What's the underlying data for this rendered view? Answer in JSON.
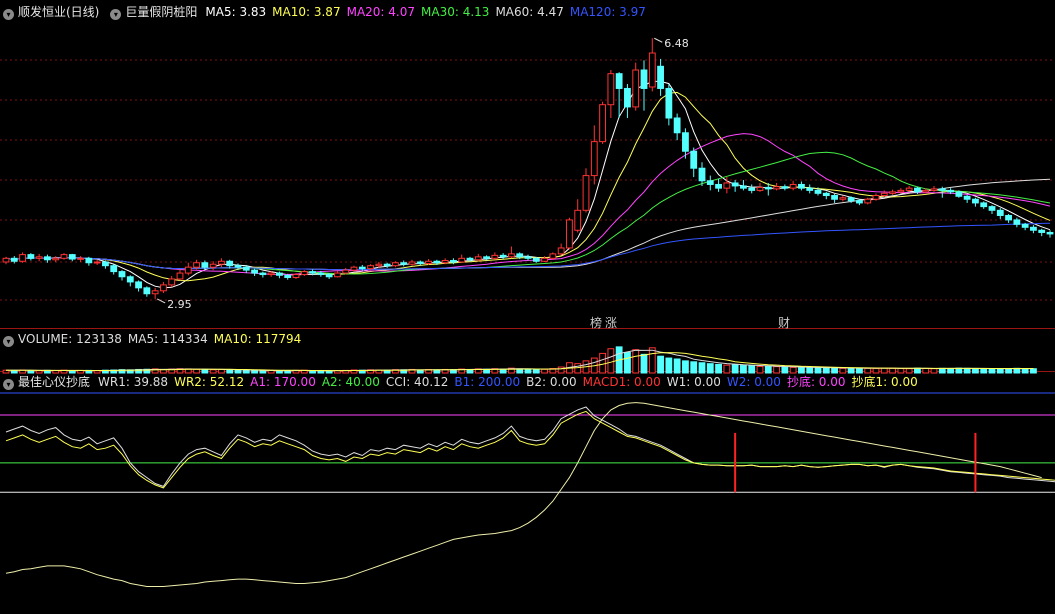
{
  "main": {
    "title": "顺发恒业(日线)",
    "indicator": "巨量假阴桩阳",
    "ma": [
      {
        "label": "MA5: 3.83",
        "color": "#ffffff"
      },
      {
        "label": "MA10: 3.87",
        "color": "#ffff55"
      },
      {
        "label": "MA20: 4.07",
        "color": "#ff44ff"
      },
      {
        "label": "MA30: 4.13",
        "color": "#44ee44"
      },
      {
        "label": "MA60: 4.47",
        "color": "#dddddd"
      },
      {
        "label": "MA120: 3.97",
        "color": "#3355ff"
      }
    ],
    "high_label": "6.48",
    "low_label": "2.95",
    "tags": [
      {
        "text": "榜",
        "color": "#ff6666"
      },
      {
        "text": "涨",
        "color": "#ff6666"
      },
      {
        "text": "财",
        "color": "#66aaff"
      }
    ]
  },
  "volume": {
    "title": "VOLUME: 123138",
    "items": [
      {
        "label": "MA5: 114334",
        "color": "#dddddd"
      },
      {
        "label": "MA10: 117794",
        "color": "#ffff55"
      }
    ]
  },
  "indicator": {
    "title": "最佳心仪抄底",
    "items": [
      {
        "label": "WR1: 39.88",
        "color": "#dddddd"
      },
      {
        "label": "WR2: 52.12",
        "color": "#ffff55"
      },
      {
        "label": "A1: 170.00",
        "color": "#ff44ff"
      },
      {
        "label": "A2: 40.00",
        "color": "#44ee44"
      },
      {
        "label": "CCI: 40.12",
        "color": "#dddddd"
      },
      {
        "label": "B1: 200.00",
        "color": "#3355ff"
      },
      {
        "label": "B2: 0.00",
        "color": "#dddddd"
      },
      {
        "label": "MACD1: 0.00",
        "color": "#ff3333"
      },
      {
        "label": "W1: 0.00",
        "color": "#dddddd"
      },
      {
        "label": "W2: 0.00",
        "color": "#3355ff"
      },
      {
        "label": "抄底: 0.00",
        "color": "#ff44ff"
      },
      {
        "label": "抄底1: 0.00",
        "color": "#ffff55"
      }
    ]
  },
  "chart_data": {
    "type": "candlestick",
    "candles": [
      [
        3.45,
        3.5,
        3.42,
        3.52
      ],
      [
        3.5,
        3.46,
        3.43,
        3.53
      ],
      [
        3.46,
        3.55,
        3.44,
        3.58
      ],
      [
        3.55,
        3.5,
        3.47,
        3.57
      ],
      [
        3.5,
        3.52,
        3.46,
        3.56
      ],
      [
        3.52,
        3.48,
        3.44,
        3.55
      ],
      [
        3.48,
        3.5,
        3.45,
        3.53
      ],
      [
        3.5,
        3.55,
        3.48,
        3.57
      ],
      [
        3.55,
        3.49,
        3.46,
        3.56
      ],
      [
        3.49,
        3.5,
        3.45,
        3.53
      ],
      [
        3.5,
        3.44,
        3.4,
        3.52
      ],
      [
        3.44,
        3.45,
        3.41,
        3.48
      ],
      [
        3.45,
        3.4,
        3.36,
        3.47
      ],
      [
        3.4,
        3.32,
        3.28,
        3.42
      ],
      [
        3.32,
        3.25,
        3.2,
        3.34
      ],
      [
        3.25,
        3.18,
        3.12,
        3.27
      ],
      [
        3.18,
        3.1,
        3.05,
        3.2
      ],
      [
        3.1,
        3.02,
        2.98,
        3.12
      ],
      [
        3.02,
        3.06,
        2.95,
        3.1
      ],
      [
        3.06,
        3.14,
        3.03,
        3.18
      ],
      [
        3.14,
        3.22,
        3.11,
        3.26
      ],
      [
        3.22,
        3.3,
        3.2,
        3.35
      ],
      [
        3.3,
        3.38,
        3.27,
        3.44
      ],
      [
        3.38,
        3.44,
        3.35,
        3.48
      ],
      [
        3.44,
        3.38,
        3.35,
        3.47
      ],
      [
        3.38,
        3.42,
        3.34,
        3.46
      ],
      [
        3.42,
        3.46,
        3.38,
        3.5
      ],
      [
        3.46,
        3.4,
        3.36,
        3.48
      ],
      [
        3.4,
        3.38,
        3.34,
        3.43
      ],
      [
        3.38,
        3.34,
        3.3,
        3.41
      ],
      [
        3.34,
        3.3,
        3.26,
        3.36
      ],
      [
        3.3,
        3.28,
        3.24,
        3.32
      ],
      [
        3.28,
        3.3,
        3.25,
        3.33
      ],
      [
        3.3,
        3.27,
        3.23,
        3.32
      ],
      [
        3.27,
        3.24,
        3.21,
        3.29
      ],
      [
        3.24,
        3.28,
        3.22,
        3.3
      ],
      [
        3.28,
        3.32,
        3.26,
        3.34
      ],
      [
        3.32,
        3.3,
        3.27,
        3.35
      ],
      [
        3.3,
        3.28,
        3.25,
        3.33
      ],
      [
        3.28,
        3.25,
        3.22,
        3.3
      ],
      [
        3.25,
        3.3,
        3.24,
        3.33
      ],
      [
        3.3,
        3.34,
        3.28,
        3.37
      ],
      [
        3.34,
        3.38,
        3.32,
        3.4
      ],
      [
        3.38,
        3.36,
        3.33,
        3.41
      ],
      [
        3.36,
        3.4,
        3.34,
        3.42
      ],
      [
        3.4,
        3.42,
        3.37,
        3.45
      ],
      [
        3.42,
        3.4,
        3.37,
        3.44
      ],
      [
        3.4,
        3.44,
        3.38,
        3.46
      ],
      [
        3.44,
        3.42,
        3.39,
        3.47
      ],
      [
        3.42,
        3.45,
        3.4,
        3.48
      ],
      [
        3.45,
        3.43,
        3.4,
        3.47
      ],
      [
        3.43,
        3.46,
        3.41,
        3.49
      ],
      [
        3.46,
        3.44,
        3.41,
        3.48
      ],
      [
        3.44,
        3.47,
        3.42,
        3.5
      ],
      [
        3.47,
        3.45,
        3.42,
        3.5
      ],
      [
        3.45,
        3.5,
        3.44,
        3.55
      ],
      [
        3.5,
        3.48,
        3.45,
        3.52
      ],
      [
        3.48,
        3.52,
        3.46,
        3.56
      ],
      [
        3.52,
        3.5,
        3.47,
        3.54
      ],
      [
        3.5,
        3.54,
        3.48,
        3.58
      ],
      [
        3.54,
        3.52,
        3.49,
        3.57
      ],
      [
        3.52,
        3.56,
        3.5,
        3.66
      ],
      [
        3.56,
        3.52,
        3.49,
        3.58
      ],
      [
        3.52,
        3.5,
        3.47,
        3.55
      ],
      [
        3.5,
        3.46,
        3.44,
        3.52
      ],
      [
        3.46,
        3.5,
        3.45,
        3.53
      ],
      [
        3.5,
        3.56,
        3.48,
        3.58
      ],
      [
        3.56,
        3.64,
        3.54,
        3.7
      ],
      [
        3.64,
        4.02,
        3.62,
        4.05
      ],
      [
        3.88,
        4.15,
        3.85,
        4.3
      ],
      [
        4.15,
        4.62,
        4.12,
        4.72
      ],
      [
        4.62,
        5.08,
        4.5,
        5.3
      ],
      [
        5.08,
        5.58,
        5.05,
        5.62
      ],
      [
        5.58,
        6.0,
        5.4,
        6.05
      ],
      [
        6.0,
        5.8,
        5.4,
        6.02
      ],
      [
        5.8,
        5.55,
        5.4,
        5.86
      ],
      [
        5.55,
        6.05,
        5.5,
        6.15
      ],
      [
        6.05,
        5.8,
        5.5,
        6.18
      ],
      [
        5.82,
        6.28,
        5.76,
        6.48
      ],
      [
        6.1,
        5.8,
        5.7,
        6.2
      ],
      [
        5.8,
        5.4,
        5.3,
        5.86
      ],
      [
        5.4,
        5.2,
        5.1,
        5.46
      ],
      [
        5.2,
        4.95,
        4.85,
        5.26
      ],
      [
        4.95,
        4.72,
        4.6,
        5.0
      ],
      [
        4.72,
        4.55,
        4.48,
        4.8
      ],
      [
        4.55,
        4.5,
        4.42,
        4.62
      ],
      [
        4.5,
        4.45,
        4.4,
        4.58
      ],
      [
        4.45,
        4.52,
        4.38,
        4.6
      ],
      [
        4.52,
        4.48,
        4.4,
        4.56
      ],
      [
        4.48,
        4.45,
        4.42,
        4.56
      ],
      [
        4.45,
        4.42,
        4.38,
        4.5
      ],
      [
        4.42,
        4.46,
        4.4,
        4.52
      ],
      [
        4.46,
        4.44,
        4.35,
        4.52
      ],
      [
        4.44,
        4.47,
        4.42,
        4.52
      ],
      [
        4.47,
        4.45,
        4.42,
        4.5
      ],
      [
        4.45,
        4.5,
        4.42,
        4.55
      ],
      [
        4.5,
        4.45,
        4.42,
        4.54
      ],
      [
        4.45,
        4.42,
        4.38,
        4.5
      ],
      [
        4.42,
        4.38,
        4.35,
        4.46
      ],
      [
        4.38,
        4.35,
        4.3,
        4.4
      ],
      [
        4.35,
        4.3,
        4.25,
        4.37
      ],
      [
        4.3,
        4.32,
        4.27,
        4.35
      ],
      [
        4.32,
        4.28,
        4.25,
        4.34
      ],
      [
        4.28,
        4.25,
        4.22,
        4.3
      ],
      [
        4.25,
        4.3,
        4.23,
        4.32
      ],
      [
        4.3,
        4.35,
        4.28,
        4.38
      ],
      [
        4.35,
        4.38,
        4.33,
        4.42
      ],
      [
        4.38,
        4.4,
        4.36,
        4.43
      ],
      [
        4.4,
        4.42,
        4.38,
        4.45
      ],
      [
        4.42,
        4.45,
        4.4,
        4.48
      ],
      [
        4.45,
        4.4,
        4.37,
        4.47
      ],
      [
        4.4,
        4.42,
        4.38,
        4.45
      ],
      [
        4.42,
        4.44,
        4.4,
        4.48
      ],
      [
        4.44,
        4.42,
        4.32,
        4.47
      ],
      [
        4.42,
        4.4,
        4.37,
        4.45
      ],
      [
        4.4,
        4.34,
        4.32,
        4.42
      ],
      [
        4.34,
        4.3,
        4.25,
        4.36
      ],
      [
        4.3,
        4.25,
        4.2,
        4.32
      ],
      [
        4.25,
        4.2,
        4.17,
        4.27
      ],
      [
        4.2,
        4.15,
        4.1,
        4.22
      ],
      [
        4.15,
        4.08,
        4.03,
        4.18
      ],
      [
        4.08,
        4.02,
        3.98,
        4.1
      ],
      [
        4.02,
        3.96,
        3.92,
        4.05
      ],
      [
        3.96,
        3.92,
        3.88,
        3.98
      ],
      [
        3.92,
        3.88,
        3.84,
        3.95
      ],
      [
        3.88,
        3.85,
        3.8,
        3.9
      ],
      [
        3.85,
        3.83,
        3.78,
        3.88
      ]
    ],
    "volume": [
      1.5,
      1.4,
      1.6,
      1.3,
      1.2,
      1.4,
      1.3,
      1.5,
      1.2,
      1.3,
      1.4,
      1.2,
      1.5,
      1.6,
      1.8,
      1.7,
      1.9,
      2.0,
      2.2,
      1.9,
      2.1,
      2.3,
      2.2,
      2.0,
      1.8,
      1.7,
      1.9,
      1.6,
      1.5,
      1.4,
      1.3,
      1.2,
      1.4,
      1.3,
      1.2,
      1.4,
      1.5,
      1.3,
      1.2,
      1.1,
      1.3,
      1.4,
      1.6,
      1.5,
      1.7,
      1.6,
      1.5,
      1.8,
      1.7,
      1.9,
      1.6,
      1.8,
      1.7,
      1.9,
      1.8,
      2.1,
      1.9,
      2.2,
      2.0,
      2.3,
      2.1,
      2.6,
      2.2,
      2.0,
      1.8,
      2.0,
      2.4,
      3.2,
      5.5,
      5.0,
      6.5,
      8.0,
      10.5,
      13.0,
      14.0,
      11.0,
      12.5,
      10.0,
      13.5,
      9.0,
      8.0,
      7.5,
      6.5,
      6.0,
      5.5,
      5.0,
      4.6,
      4.2,
      4.5,
      4.0,
      3.8,
      3.5,
      3.6,
      3.4,
      3.2,
      3.0,
      2.8,
      3.0,
      2.9,
      2.7,
      2.6,
      2.5,
      2.7,
      2.6,
      2.5,
      2.4,
      2.6,
      2.5,
      2.4,
      2.3,
      2.6,
      2.4,
      2.3,
      2.5,
      2.4,
      2.6,
      2.5,
      2.4,
      2.3,
      2.2,
      2.4,
      2.3,
      2.5,
      2.4,
      2.3
    ],
    "volume_max": 15,
    "indicator_series": {
      "wr1": [
        82,
        86,
        90,
        84,
        80,
        85,
        88,
        78,
        72,
        70,
        75,
        66,
        70,
        74,
        60,
        40,
        28,
        20,
        12,
        8,
        25,
        40,
        52,
        58,
        60,
        55,
        50,
        66,
        78,
        74,
        68,
        72,
        70,
        78,
        74,
        70,
        64,
        56,
        52,
        50,
        52,
        48,
        54,
        50,
        58,
        56,
        60,
        58,
        64,
        62,
        60,
        66,
        62,
        68,
        64,
        72,
        68,
        66,
        70,
        74,
        80,
        90,
        76,
        72,
        70,
        72,
        84,
        100,
        106,
        112,
        116,
        104,
        98,
        92,
        86,
        78,
        76,
        72,
        68,
        64,
        58,
        52,
        46,
        40,
        38,
        37,
        37,
        36,
        36,
        36,
        37,
        35,
        35,
        35,
        36,
        35,
        37,
        35,
        34,
        35,
        36,
        37,
        38,
        38,
        36,
        37,
        34,
        37,
        38,
        36,
        34,
        33,
        32,
        30,
        28,
        27,
        26,
        25,
        24,
        23,
        22,
        20,
        19,
        18,
        17,
        16,
        15,
        14,
        14,
        15,
        16
      ],
      "wr2": [
        70,
        74,
        78,
        72,
        68,
        72,
        76,
        68,
        62,
        60,
        66,
        58,
        60,
        64,
        52,
        36,
        24,
        16,
        10,
        6,
        20,
        34,
        46,
        52,
        55,
        50,
        46,
        60,
        72,
        68,
        62,
        66,
        64,
        70,
        66,
        62,
        58,
        50,
        46,
        44,
        46,
        42,
        48,
        46,
        52,
        50,
        54,
        52,
        58,
        56,
        54,
        60,
        56,
        62,
        58,
        66,
        62,
        60,
        64,
        68,
        74,
        84,
        70,
        66,
        64,
        66,
        78,
        94,
        100,
        106,
        110,
        100,
        94,
        88,
        82,
        76,
        74,
        70,
        66,
        62,
        56,
        50,
        44,
        40,
        38,
        37,
        37,
        36,
        36,
        36,
        37,
        35,
        35,
        35,
        36,
        35,
        37,
        35,
        34,
        35,
        36,
        37,
        38,
        38,
        36,
        37,
        35,
        37,
        38,
        36,
        35,
        34,
        33,
        31,
        29,
        28,
        27,
        26,
        25,
        24,
        23,
        22,
        21,
        20,
        19,
        18,
        17,
        16,
        16,
        17,
        18
      ],
      "cci": [
        -110,
        -108,
        -105,
        -104,
        -102,
        -100,
        -100,
        -100,
        -102,
        -104,
        -108,
        -112,
        -115,
        -118,
        -120,
        -124,
        -126,
        -128,
        -128,
        -128,
        -127,
        -126,
        -125,
        -124,
        -122,
        -121,
        -120,
        -119,
        -118,
        -118,
        -119,
        -120,
        -121,
        -122,
        -123,
        -124,
        -124,
        -123,
        -122,
        -120,
        -118,
        -116,
        -112,
        -108,
        -104,
        -100,
        -96,
        -92,
        -88,
        -84,
        -80,
        -76,
        -72,
        -68,
        -64,
        -62,
        -60,
        -58,
        -57,
        -56,
        -54,
        -52,
        -48,
        -42,
        -34,
        -24,
        -12,
        4,
        20,
        40,
        62,
        84,
        100,
        112,
        118,
        121,
        122,
        121,
        119,
        117,
        115,
        113,
        111,
        109,
        107,
        105,
        103,
        101,
        99,
        97,
        95,
        93,
        91,
        89,
        87,
        85,
        83,
        81,
        79,
        77,
        75,
        73,
        71,
        69,
        67,
        65,
        63,
        61,
        59,
        57,
        55,
        53,
        51,
        49,
        47,
        45,
        43,
        41,
        39,
        37,
        35,
        32,
        29,
        26,
        23,
        20
      ],
      "macd_signals": [
        88,
        117
      ]
    },
    "price_range": [
      2.8,
      6.7
    ],
    "indicator_range": [
      -160,
      135
    ],
    "levels": {
      "A1": 170,
      "A2": 40,
      "B1": 200,
      "B2": 0
    }
  }
}
